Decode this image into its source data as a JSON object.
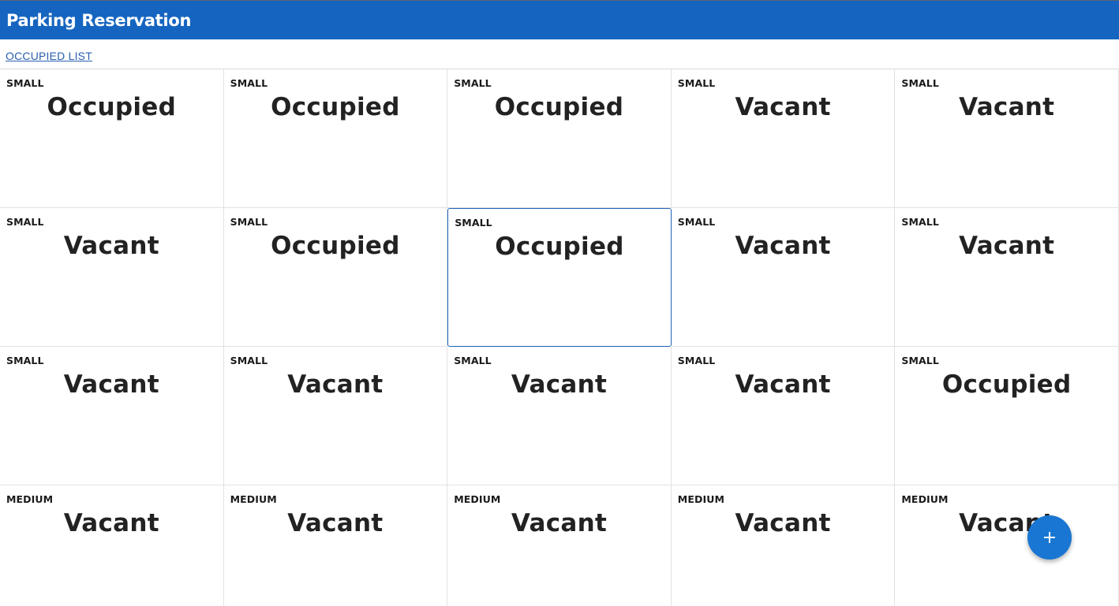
{
  "app_bar": {
    "title": "Parking Reservation"
  },
  "nav": {
    "occupied_list_label": "OCCUPIED LIST"
  },
  "slots": [
    {
      "size": "SMALL",
      "status": "Occupied"
    },
    {
      "size": "SMALL",
      "status": "Occupied"
    },
    {
      "size": "SMALL",
      "status": "Occupied"
    },
    {
      "size": "SMALL",
      "status": "Vacant"
    },
    {
      "size": "SMALL",
      "status": "Vacant"
    },
    {
      "size": "SMALL",
      "status": "Vacant"
    },
    {
      "size": "SMALL",
      "status": "Occupied"
    },
    {
      "size": "SMALL",
      "status": "Occupied"
    },
    {
      "size": "SMALL",
      "status": "Vacant"
    },
    {
      "size": "SMALL",
      "status": "Vacant"
    },
    {
      "size": "SMALL",
      "status": "Vacant"
    },
    {
      "size": "SMALL",
      "status": "Vacant"
    },
    {
      "size": "SMALL",
      "status": "Vacant"
    },
    {
      "size": "SMALL",
      "status": "Vacant"
    },
    {
      "size": "SMALL",
      "status": "Occupied"
    },
    {
      "size": "MEDIUM",
      "status": "Vacant"
    },
    {
      "size": "MEDIUM",
      "status": "Vacant"
    },
    {
      "size": "MEDIUM",
      "status": "Vacant"
    },
    {
      "size": "MEDIUM",
      "status": "Vacant"
    },
    {
      "size": "MEDIUM",
      "status": "Vacant"
    }
  ],
  "fab": {
    "icon": "plus-icon"
  },
  "colors": {
    "app_bar": "#1565c0",
    "fab": "#1976d2",
    "link": "#2a5db0"
  }
}
